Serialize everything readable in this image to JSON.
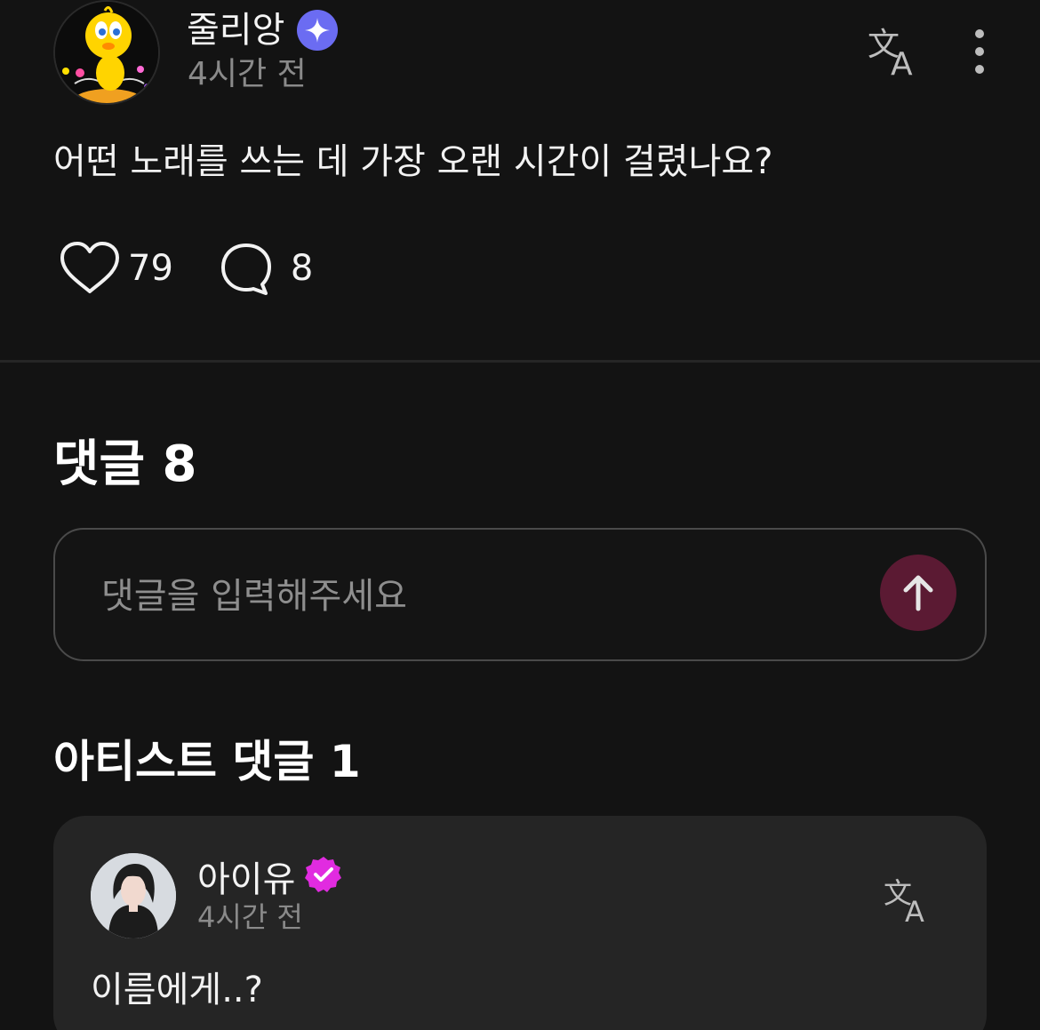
{
  "post": {
    "author": "줄리앙",
    "author_badge_icon": "star-badge-icon",
    "time": "4시간 전",
    "body": "어떤 노래를 쓰는 데 가장 오랜 시간이 걸렸나요?",
    "likes": "79",
    "comments": "8"
  },
  "comments": {
    "title": "댓글 8",
    "input_placeholder": "댓글을 입력해주세요",
    "input_value": "",
    "send_icon": "arrow-up-icon"
  },
  "artist_comments": {
    "title": "아티스트 댓글 1",
    "items": [
      {
        "author": "아이유",
        "badge_icon": "verified-badge-icon",
        "time": "4시간 전",
        "body": "이름에게..?"
      }
    ]
  },
  "colors": {
    "background": "#131313",
    "star_badge": "#6b6cf2",
    "verified_badge": "#e12be0",
    "send_button": "#5b1a33",
    "card": "#252525"
  }
}
